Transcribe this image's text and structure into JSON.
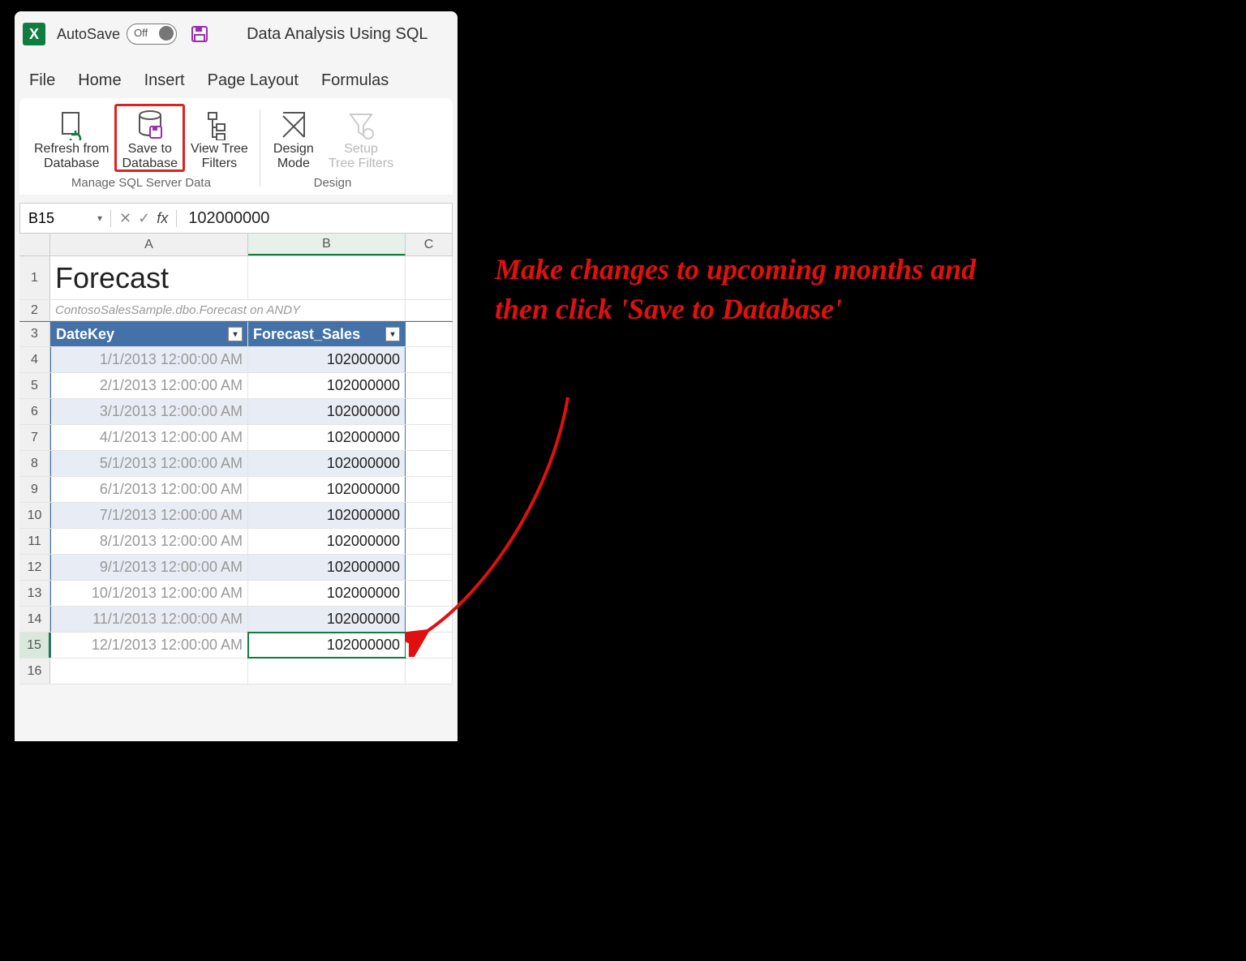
{
  "titlebar": {
    "autosave_label": "AutoSave",
    "autosave_state": "Off",
    "doc_title": "Data Analysis Using SQL"
  },
  "tabs": [
    "File",
    "Home",
    "Insert",
    "Page Layout",
    "Formulas"
  ],
  "ribbon": {
    "group1_label": "Manage SQL Server Data",
    "group2_label": "Design",
    "btn_refresh_l1": "Refresh from",
    "btn_refresh_l2": "Database",
    "btn_save_l1": "Save to",
    "btn_save_l2": "Database",
    "btn_filters_l1": "View Tree",
    "btn_filters_l2": "Filters",
    "btn_design_l1": "Design",
    "btn_design_l2": "Mode",
    "btn_setup_l1": "Setup",
    "btn_setup_l2": "Tree Filters"
  },
  "formula": {
    "cell_ref": "B15",
    "value": "102000000"
  },
  "columns": {
    "a": "A",
    "b": "B",
    "c": "C"
  },
  "sheet": {
    "title": "Forecast",
    "subtitle": "ContosoSalesSample.dbo.Forecast on ANDY",
    "header_a": "DateKey",
    "header_b": "Forecast_Sales",
    "rows": [
      {
        "n": "4",
        "date": "1/1/2013 12:00:00 AM",
        "val": "102000000",
        "alt": true
      },
      {
        "n": "5",
        "date": "2/1/2013 12:00:00 AM",
        "val": "102000000",
        "alt": false
      },
      {
        "n": "6",
        "date": "3/1/2013 12:00:00 AM",
        "val": "102000000",
        "alt": true
      },
      {
        "n": "7",
        "date": "4/1/2013 12:00:00 AM",
        "val": "102000000",
        "alt": false
      },
      {
        "n": "8",
        "date": "5/1/2013 12:00:00 AM",
        "val": "102000000",
        "alt": true
      },
      {
        "n": "9",
        "date": "6/1/2013 12:00:00 AM",
        "val": "102000000",
        "alt": false
      },
      {
        "n": "10",
        "date": "7/1/2013 12:00:00 AM",
        "val": "102000000",
        "alt": true
      },
      {
        "n": "11",
        "date": "8/1/2013 12:00:00 AM",
        "val": "102000000",
        "alt": false
      },
      {
        "n": "12",
        "date": "9/1/2013 12:00:00 AM",
        "val": "102000000",
        "alt": true
      },
      {
        "n": "13",
        "date": "10/1/2013 12:00:00 AM",
        "val": "102000000",
        "alt": false
      },
      {
        "n": "14",
        "date": "11/1/2013 12:00:00 AM",
        "val": "102000000",
        "alt": true
      },
      {
        "n": "15",
        "date": "12/1/2013 12:00:00 AM",
        "val": "102000000",
        "alt": false,
        "selected": true
      }
    ],
    "row1": "1",
    "row2": "2",
    "row3": "3",
    "row16": "16"
  },
  "annotation": {
    "text": "Make changes to upcoming months and then click 'Save to Database'"
  }
}
